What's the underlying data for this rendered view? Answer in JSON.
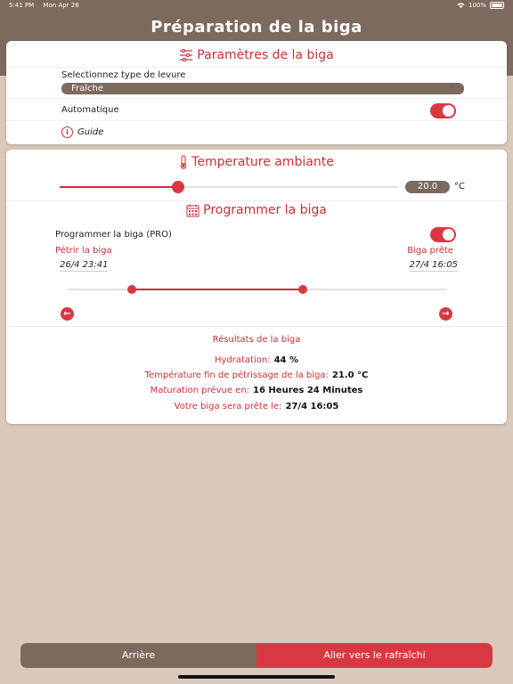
{
  "status": {
    "time": "5:41 PM",
    "date": "Mon Apr 26",
    "battery": "100%"
  },
  "title": "Préparation de la biga",
  "params": {
    "header": "Paramètres de la biga",
    "yeast_label": "Selectionnez type de levure",
    "yeast_value": "Fraîche",
    "auto_label": "Automatique",
    "auto_on": true,
    "guide": "Guide"
  },
  "temperature": {
    "header": "Temperature ambiante",
    "value": "20.0",
    "unit": "°C",
    "slider_fraction": 0.35
  },
  "schedule": {
    "header": "Programmer la biga",
    "toggle_label": "Programmer la biga (PRO)",
    "toggle_on": true,
    "start_label": "Pétrir la biga",
    "start_date": "26/4 23:41",
    "end_label": "Biga prête",
    "end_date": "27/4 16:05",
    "range_start_fraction": 0.17,
    "range_end_fraction": 0.62
  },
  "results": {
    "title": "Résultats de la biga",
    "rows": [
      {
        "label": "Hydratation:",
        "value": "44 %"
      },
      {
        "label": "Température fin de pétrissage de la biga:",
        "value": "21.0 °C"
      },
      {
        "label": "Maturation prévue en:",
        "value": "16 Heures 24 Minutes"
      },
      {
        "label": "Votre biga sera prête le:",
        "value": "27/4 16:05"
      }
    ]
  },
  "buttons": {
    "back": "Arrière",
    "next": "Aller vers le rafraîchi"
  },
  "colors": {
    "brown": "#7d6a5e",
    "red": "#d93843",
    "background": "#d9c9bb"
  }
}
